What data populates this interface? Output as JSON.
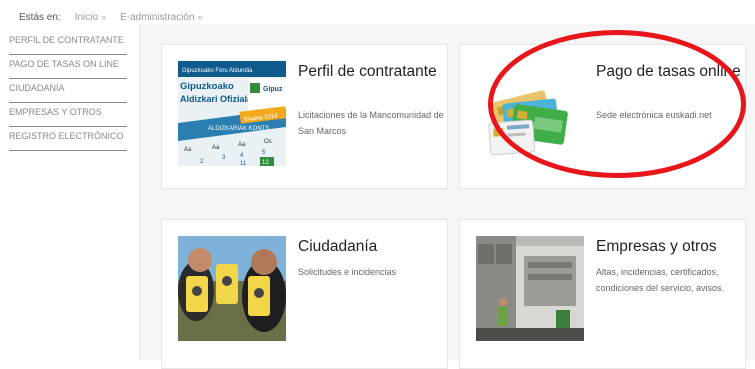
{
  "breadcrumb": {
    "label": "Estás en:",
    "items": [
      {
        "text": "Inicio",
        "sep": "»"
      },
      {
        "text": "E-administración",
        "sep": "»"
      }
    ]
  },
  "sidebar": {
    "items": [
      {
        "label": "PERFIL DE CONTRATANTE"
      },
      {
        "label": "PAGO DE TASAS ON LINE"
      },
      {
        "label": "CIUDADANÍA"
      },
      {
        "label": "EMPRESAS Y OTROS"
      },
      {
        "label": "REGISTRO ELECTRÓNICO"
      }
    ]
  },
  "cards": {
    "perfil": {
      "title": "Perfil de contratante",
      "desc": "Licitaciones de la Mancomunidad de San Marcos",
      "thumb": {
        "header": "Gipuzkoako Foru Aldundia",
        "line1": "Gipuzkoako",
        "line2": "Aldizkari Ofiziala",
        "side": "Gipuz",
        "band": "ALDIZKARIAK KONTS",
        "month": "Ekaina 2014",
        "days": [
          "Aa",
          "Aa",
          "Aa",
          "Os"
        ],
        "nums": [
          "2",
          "3",
          "4",
          "5",
          "11",
          "12"
        ]
      }
    },
    "pago": {
      "title": "Pago de tasas online",
      "desc": "Sede electrónica euskadi.net"
    },
    "ciudadania": {
      "title": "Ciudadanía",
      "desc": "Solicitudes e incidencias"
    },
    "empresas": {
      "title": "Empresas y otros",
      "desc": "Altas, incidencias, certificados, condiciones del servicio, avisos."
    }
  },
  "colors": {
    "highlight": "#e8151b",
    "sidebar_text": "#888888",
    "content_bg": "#f6f6f6"
  },
  "icons": [
    "calendar-thumbnail",
    "credit-cards-thumbnail",
    "people-cups-thumbnail",
    "garbage-truck-thumbnail"
  ]
}
